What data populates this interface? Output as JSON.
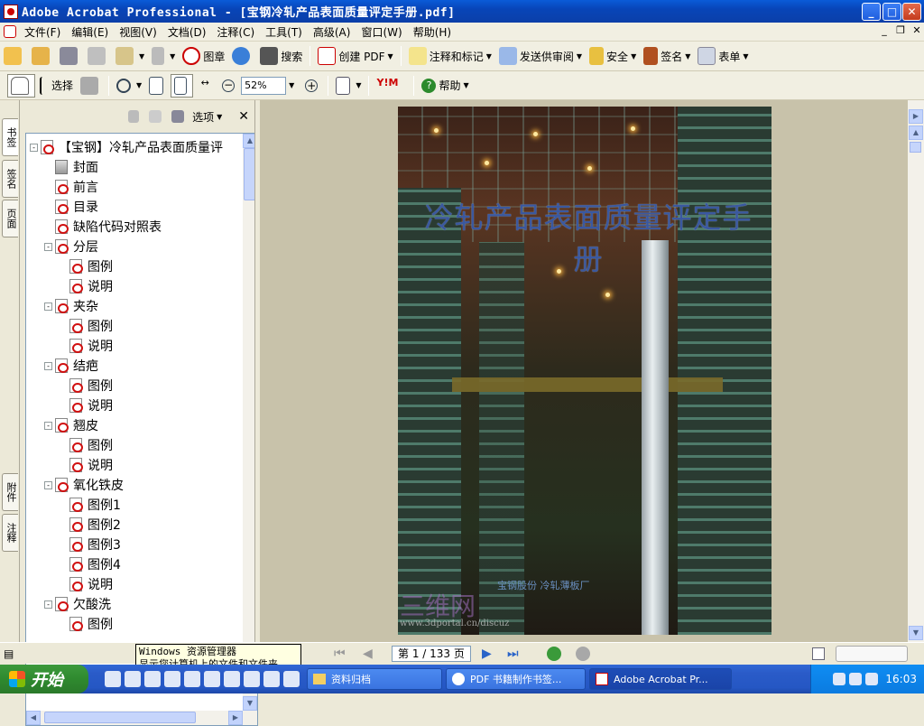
{
  "window": {
    "title": "Adobe Acrobat Professional - [宝钢冷轧产品表面质量评定手册.pdf]",
    "min": "_",
    "max": "□",
    "close": "✕"
  },
  "menu": [
    "文件(F)",
    "编辑(E)",
    "视图(V)",
    "文档(D)",
    "注释(C)",
    "工具(T)",
    "高级(A)",
    "窗口(W)",
    "帮助(H)"
  ],
  "toolbar1": {
    "stamp": "图章",
    "search": "搜索",
    "create_pdf": "创建 PDF",
    "comment_markup": "注释和标记",
    "send_review": "发送供审阅",
    "security": "安全",
    "sign": "签名",
    "forms": "表单"
  },
  "toolbar2": {
    "select": "选择",
    "zoom_value": "52%",
    "help": "帮助"
  },
  "side_tabs": {
    "bookmarks": "书签",
    "signatures": "签名",
    "pages": "页面",
    "attachments": "附件",
    "comments": "注释"
  },
  "nav": {
    "options": "选项",
    "bookmarks": [
      {
        "label": "【宝钢】冷轧产品表面质量评",
        "level": 0,
        "exp": "⊟"
      },
      {
        "label": "封面",
        "level": 1
      },
      {
        "label": "前言",
        "level": 1
      },
      {
        "label": "目录",
        "level": 1
      },
      {
        "label": "缺陷代码对照表",
        "level": 1
      },
      {
        "label": "分层",
        "level": 1,
        "exp": "⊟"
      },
      {
        "label": "图例",
        "level": 2
      },
      {
        "label": "说明",
        "level": 2
      },
      {
        "label": "夹杂",
        "level": 1,
        "exp": "⊟"
      },
      {
        "label": "图例",
        "level": 2
      },
      {
        "label": "说明",
        "level": 2
      },
      {
        "label": "结疤",
        "level": 1,
        "exp": "⊟"
      },
      {
        "label": "图例",
        "level": 2
      },
      {
        "label": "说明",
        "level": 2
      },
      {
        "label": "翘皮",
        "level": 1,
        "exp": "⊟"
      },
      {
        "label": "图例",
        "level": 2
      },
      {
        "label": "说明",
        "level": 2
      },
      {
        "label": "氧化铁皮",
        "level": 1,
        "exp": "⊟"
      },
      {
        "label": "图例1",
        "level": 2
      },
      {
        "label": "图例2",
        "level": 2
      },
      {
        "label": "图例3",
        "level": 2
      },
      {
        "label": "图例4",
        "level": 2
      },
      {
        "label": "说明",
        "level": 2
      },
      {
        "label": "欠酸洗",
        "level": 1,
        "exp": "⊟"
      },
      {
        "label": "图例",
        "level": 2
      }
    ]
  },
  "cover": {
    "title": "冷轧产品表面质量评定手册",
    "publisher": "宝钢股份 冷轧薄板厂",
    "watermark": "三维网",
    "watermark_url": "www.3dportal.cn/discuz"
  },
  "status": {
    "page_label": "第 1 / 133 页"
  },
  "tooltip": {
    "line1": "Windows 资源管理器",
    "line2": "显示您计算机上的文件和文件夹。"
  },
  "taskbar": {
    "start": "开始",
    "tasks": [
      "资料归档",
      "PDF 书籍制作书签...",
      "Adobe Acrobat Pr..."
    ],
    "clock": "16:03"
  },
  "colors": {
    "accent": "#0a5bd8",
    "taskbar": "#2557c4",
    "start": "#2f8a2f"
  }
}
